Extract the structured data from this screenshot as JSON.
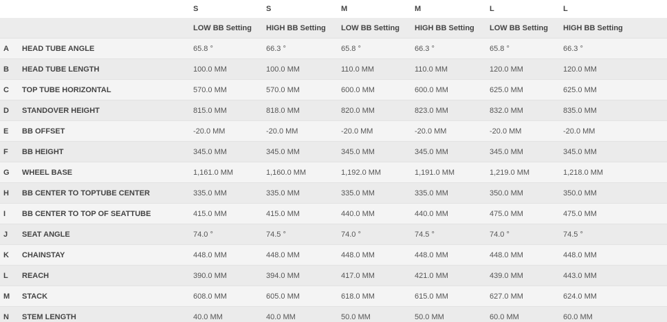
{
  "sizes": [
    "S",
    "S",
    "M",
    "M",
    "L",
    "L"
  ],
  "settings": [
    "LOW BB Setting",
    "HIGH BB Setting",
    "LOW BB Setting",
    "HIGH BB Setting",
    "LOW BB Setting",
    "HIGH BB Setting"
  ],
  "rows": [
    {
      "letter": "A",
      "name": "HEAD TUBE ANGLE",
      "values": [
        "65.8 °",
        "66.3 °",
        "65.8 °",
        "66.3 °",
        "65.8 °",
        "66.3 °"
      ]
    },
    {
      "letter": "B",
      "name": "HEAD TUBE LENGTH",
      "values": [
        "100.0 MM",
        "100.0 MM",
        "110.0 MM",
        "110.0 MM",
        "120.0 MM",
        "120.0 MM"
      ]
    },
    {
      "letter": "C",
      "name": "TOP TUBE HORIZONTAL",
      "values": [
        "570.0 MM",
        "570.0 MM",
        "600.0 MM",
        "600.0 MM",
        "625.0 MM",
        "625.0 MM"
      ]
    },
    {
      "letter": "D",
      "name": "STANDOVER HEIGHT",
      "values": [
        "815.0 MM",
        "818.0 MM",
        "820.0 MM",
        "823.0 MM",
        "832.0 MM",
        "835.0 MM"
      ]
    },
    {
      "letter": "E",
      "name": "BB OFFSET",
      "values": [
        "-20.0 MM",
        "-20.0 MM",
        "-20.0 MM",
        "-20.0 MM",
        "-20.0 MM",
        "-20.0 MM"
      ]
    },
    {
      "letter": "F",
      "name": "BB HEIGHT",
      "values": [
        "345.0 MM",
        "345.0 MM",
        "345.0 MM",
        "345.0 MM",
        "345.0 MM",
        "345.0 MM"
      ]
    },
    {
      "letter": "G",
      "name": "WHEEL BASE",
      "values": [
        "1,161.0 MM",
        "1,160.0 MM",
        "1,192.0 MM",
        "1,191.0 MM",
        "1,219.0 MM",
        "1,218.0 MM"
      ]
    },
    {
      "letter": "H",
      "name": "BB CENTER TO TOPTUBE CENTER",
      "values": [
        "335.0 MM",
        "335.0 MM",
        "335.0 MM",
        "335.0 MM",
        "350.0 MM",
        "350.0 MM"
      ]
    },
    {
      "letter": "I",
      "name": "BB CENTER TO TOP OF SEATTUBE",
      "values": [
        "415.0 MM",
        "415.0 MM",
        "440.0 MM",
        "440.0 MM",
        "475.0 MM",
        "475.0 MM"
      ]
    },
    {
      "letter": "J",
      "name": "SEAT ANGLE",
      "values": [
        "74.0 °",
        "74.5 °",
        "74.0 °",
        "74.5 °",
        "74.0 °",
        "74.5 °"
      ]
    },
    {
      "letter": "K",
      "name": "CHAINSTAY",
      "values": [
        "448.0 MM",
        "448.0 MM",
        "448.0 MM",
        "448.0 MM",
        "448.0 MM",
        "448.0 MM"
      ]
    },
    {
      "letter": "L",
      "name": "REACH",
      "values": [
        "390.0 MM",
        "394.0 MM",
        "417.0 MM",
        "421.0 MM",
        "439.0 MM",
        "443.0 MM"
      ]
    },
    {
      "letter": "M",
      "name": "STACK",
      "values": [
        "608.0 MM",
        "605.0 MM",
        "618.0 MM",
        "615.0 MM",
        "627.0 MM",
        "624.0 MM"
      ]
    },
    {
      "letter": "N",
      "name": "STEM LENGTH",
      "values": [
        "40.0 MM",
        "40.0 MM",
        "50.0 MM",
        "50.0 MM",
        "60.0 MM",
        "60.0 MM"
      ]
    }
  ]
}
